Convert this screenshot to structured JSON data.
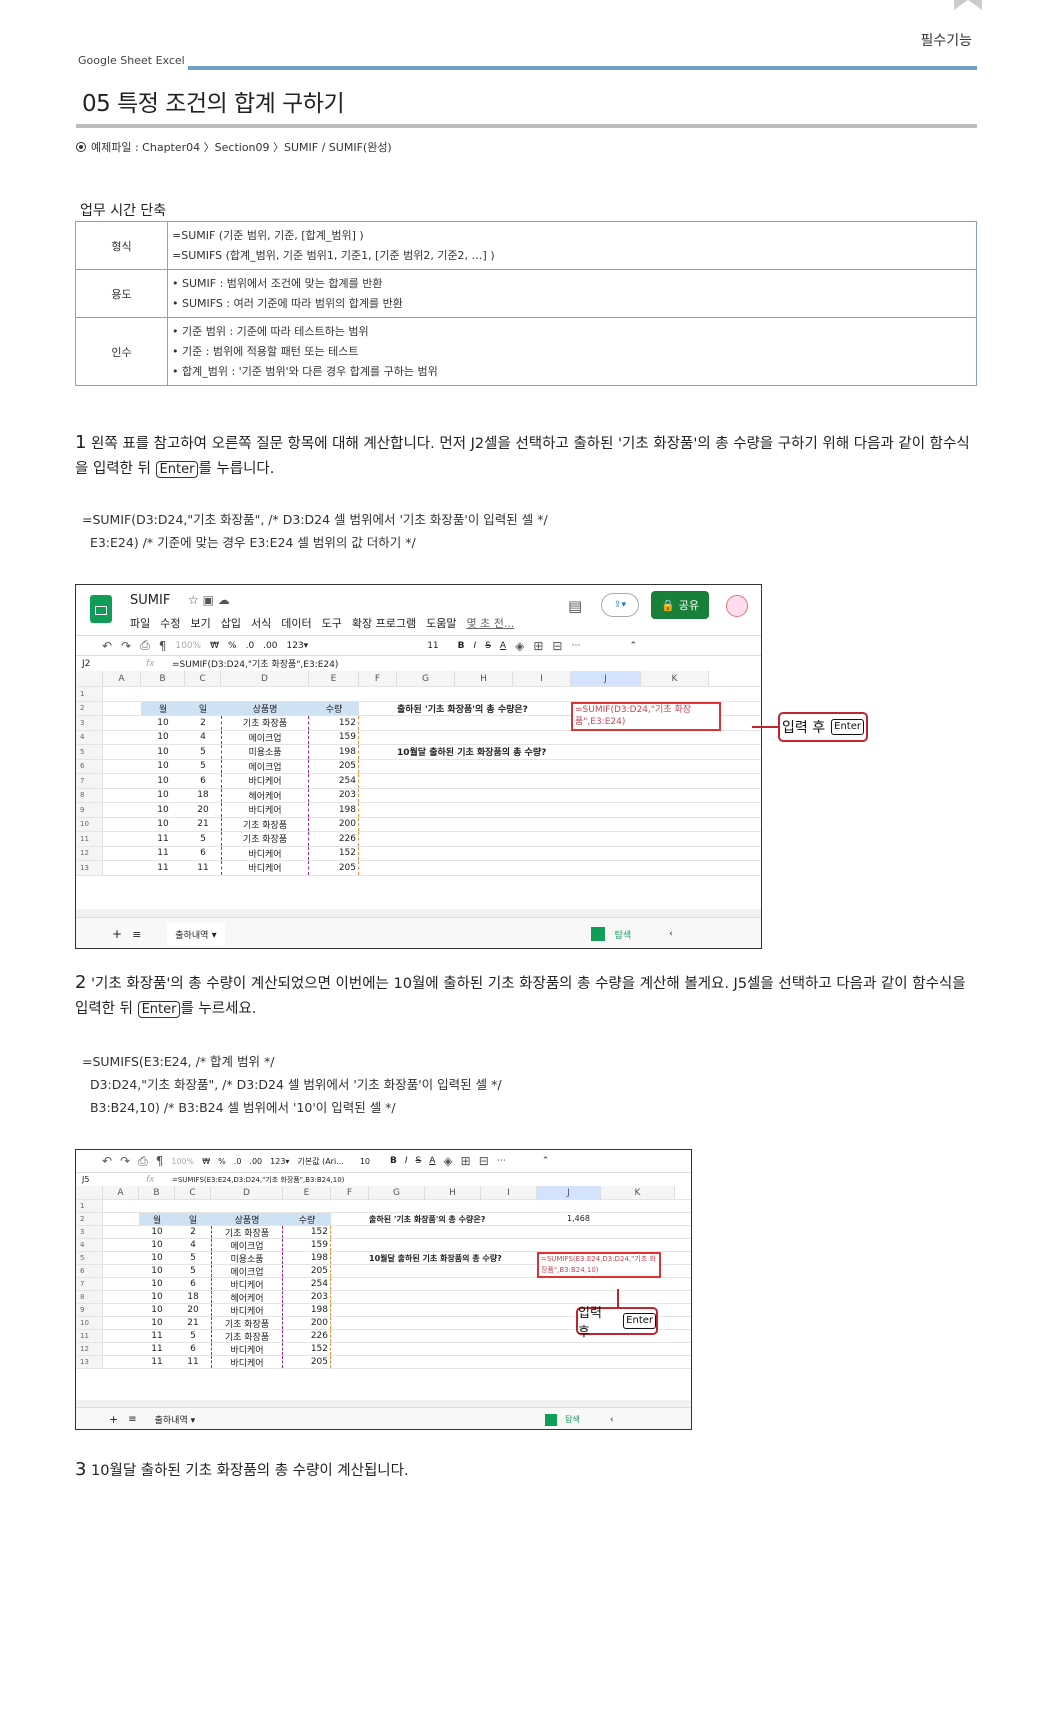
{
  "header": {
    "chapter_tag": "필수기능",
    "book_label": "Google Sheet  Excel",
    "title": "05 특정 조건의 합계 구하기",
    "example_file": "예제파일 : Chapter04 〉Section09 〉SUMIF / SUMIF(완성)"
  },
  "section_title": "업무 시간 단축",
  "fn_table": [
    {
      "key": "형식",
      "lines": [
        "=SUMIF (기준 범위, 기준, [합계_범위] )",
        "=SUMIFS (합계_범위, 기준 범위1, 기준1, [기준 범위2, 기준2, …] )"
      ]
    },
    {
      "key": "용도",
      "lines": [
        "• SUMIF : 범위에서 조건에 맞는 합계를 반환",
        "• SUMIFS : 여러 기준에 따라 범위의 합계를 반환"
      ]
    },
    {
      "key": "인수",
      "lines": [
        "• 기준 범위 : 기준에 따라 테스트하는 범위",
        "• 기준 : 범위에 적용할 패턴 또는 테스트",
        "• 합계_범위 : '기준 범위'와 다른 경우 합계를 구하는 범위"
      ]
    }
  ],
  "step1": {
    "num": "1",
    "text_a": " 왼쪽 표를 참고하여 오른쪽 질문 항목에 대해 계산합니다. 먼저 J2셀을 선택하고 출하된 '기초 화장품'의 총 수량을 구하기 위해 다음과 같이 함수식을 입력한 뒤 ",
    "key": "Enter",
    "text_b": "를 누릅니다."
  },
  "code1": "=SUMIF(D3:D24,\"기초 화장품\", /* D3:D24 셀 범위에서 '기초 화장품'이 입력된 셀 */\n  E3:E24) /* 기준에 맞는 경우 E3:E24 셀 범위의 값 더하기 */",
  "step2": {
    "num": "2",
    "text_a": " '기초 화장품'의 총 수량이 계산되었으면 이번에는 10월에 출하된 기초 화장품의 총 수량을 계산해 볼게요. J5셀을 선택하고 다음과 같이 함수식을 입력한 뒤 ",
    "key": "Enter",
    "text_b": "를 누르세요."
  },
  "code2": "=SUMIFS(E3:E24, /* 합계 범위 */\n  D3:D24,\"기초 화장품\", /* D3:D24 셀 범위에서 '기초 화장품'이 입력된 셀 */\n  B3:B24,10) /* B3:B24 셀 범위에서 '10'이 입력된 셀 */",
  "step3": {
    "num": "3",
    "text": " 10월달 출하된 기초 화장품의 총 수량이 계산됩니다."
  },
  "sheet1": {
    "doc_title": "SUMIF",
    "menus": [
      "파일",
      "수정",
      "보기",
      "삽입",
      "서식",
      "데이터",
      "도구",
      "확장 프로그램",
      "도움말",
      "몇 초 전..."
    ],
    "share": "공유",
    "zoom": "100%",
    "currency": "₩",
    "percent": "%",
    "dec1": ".0",
    "dec2": ".00",
    "fmt": "123▾",
    "fontsize": "11",
    "namebox": "J2",
    "formula": "=SUMIF(D3:D24,\"기초 화장품\",E3:E24)",
    "cols": [
      "A",
      "B",
      "C",
      "D",
      "E",
      "F",
      "G",
      "H",
      "I",
      "J",
      "K"
    ],
    "q1": "출하된 '기초 화장품'의 총 수량은?",
    "q2": "10월달 출하된 기초 화장품의 총 수량?",
    "active_text": "=SUMIF(D3:D24,\"기초 화장품\",E3:E24)",
    "callout": "입력 후",
    "callout_key": "Enter",
    "sheet_tab": "출하내역",
    "explore": "탐색"
  },
  "sheet2": {
    "zoom": "100%",
    "currency": "₩",
    "percent": "%",
    "dec1": ".0",
    "dec2": ".00",
    "fmt": "123▾",
    "font": "기본값 (Ari...",
    "fontsize": "10",
    "namebox": "J5",
    "formula": "=SUMIFS(E3:E24,D3:D24,\"기초 화장품\",B3:B24,10)",
    "cols": [
      "A",
      "B",
      "C",
      "D",
      "E",
      "F",
      "G",
      "H",
      "I",
      "J",
      "K"
    ],
    "q1": "출하된 '기초 화장품'의 총 수량은?",
    "a1": "1,468",
    "q2": "10월달 출하된 기초 화장품의 총 수량?",
    "active_text": "=SUMIFS(E3:E24,D3:D24,\"기초 화장품\",B3:B24,10)",
    "callout": "입력 후",
    "callout_key": "Enter",
    "sheet_tab": "출하내역",
    "explore": "탐색"
  },
  "table_headers": [
    "월",
    "일",
    "상품명",
    "수량"
  ],
  "table_rows": [
    [
      "10",
      "2",
      "기초 화장품",
      "152"
    ],
    [
      "10",
      "4",
      "메이크업",
      "159"
    ],
    [
      "10",
      "5",
      "미용소품",
      "198"
    ],
    [
      "10",
      "5",
      "메이크업",
      "205"
    ],
    [
      "10",
      "6",
      "바디케어",
      "254"
    ],
    [
      "10",
      "18",
      "헤어케어",
      "203"
    ],
    [
      "10",
      "20",
      "바디케어",
      "198"
    ],
    [
      "10",
      "21",
      "기초 화장품",
      "200"
    ],
    [
      "11",
      "5",
      "기초 화장품",
      "226"
    ],
    [
      "11",
      "6",
      "바디케어",
      "152"
    ],
    [
      "11",
      "11",
      "바디케어",
      "205"
    ]
  ],
  "row_numbers": [
    "1",
    "2",
    "3",
    "4",
    "5",
    "6",
    "7",
    "8",
    "9",
    "10",
    "11",
    "12",
    "13"
  ],
  "colors": {
    "accent_blue": "#6fa0c5",
    "callout_red": "#c0262d",
    "sheets_green": "#0f9d58"
  }
}
